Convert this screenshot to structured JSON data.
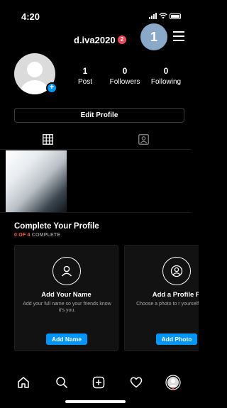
{
  "status_bar": {
    "time": "4:20"
  },
  "header": {
    "username": "d.iva2020",
    "notification_count": "2",
    "step_marker": "1"
  },
  "profile": {
    "stats": [
      {
        "value": "1",
        "label": "Post"
      },
      {
        "value": "0",
        "label": "Followers"
      },
      {
        "value": "0",
        "label": "Following"
      }
    ],
    "edit_button": "Edit Profile"
  },
  "tabs": [
    {
      "icon": "grid-icon",
      "active": true
    },
    {
      "icon": "tagged-person-icon",
      "active": false
    }
  ],
  "complete_profile": {
    "title": "Complete Your Profile",
    "progress": "0 OF 4",
    "progress_suffix": "COMPLETE",
    "cards": [
      {
        "icon": "person-icon",
        "title": "Add Your Name",
        "description": "Add your full name so your friends know it's you.",
        "button": "Add Name"
      },
      {
        "icon": "profile-photo-icon",
        "title": "Add a Profile P",
        "description": "Choose a photo to r yourself on Insta",
        "button": "Add Photo"
      }
    ]
  },
  "bottom_nav": [
    {
      "icon": "home-icon"
    },
    {
      "icon": "search-icon"
    },
    {
      "icon": "new-post-icon"
    },
    {
      "icon": "heart-icon"
    },
    {
      "icon": "profile-avatar-icon"
    }
  ],
  "colors": {
    "accent": "#0095f6",
    "badge": "#ed4956",
    "progress": "#f56040",
    "step_marker": "#8aa9c9"
  }
}
